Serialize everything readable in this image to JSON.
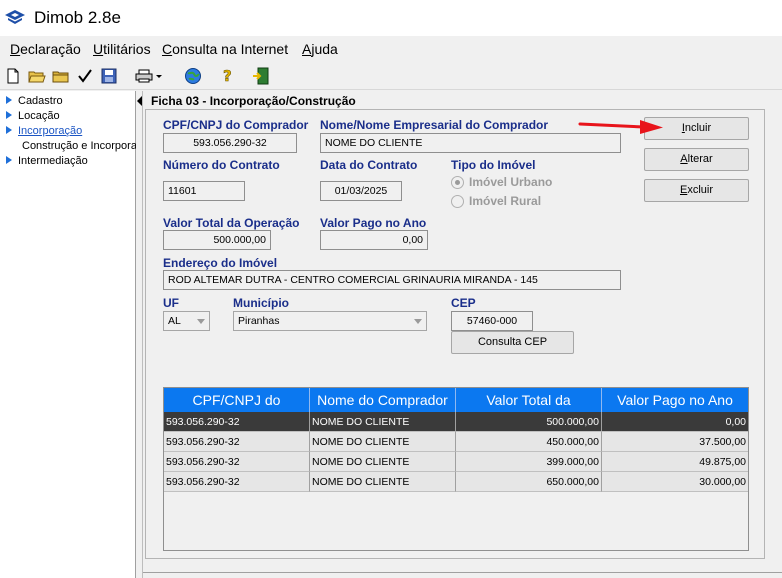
{
  "app": {
    "title": "Dimob 2.8e"
  },
  "menu": [
    {
      "ul": "D",
      "rest": "eclaração"
    },
    {
      "ul": "U",
      "rest": "tilitários"
    },
    {
      "ul": "C",
      "rest": "onsulta na Internet"
    },
    {
      "ul": "A",
      "rest": "juda"
    }
  ],
  "toolbar": {
    "icons": [
      "new-file-icon",
      "open-folder-icon",
      "folder-icon",
      "check-icon",
      "save-icon",
      "print-icon",
      "globe-icon",
      "help-icon",
      "exit-icon"
    ]
  },
  "sidebar": {
    "items": [
      {
        "label": "Cadastro"
      },
      {
        "label": "Locação"
      },
      {
        "label": "Incorporação"
      },
      {
        "label": "Intermediação"
      }
    ],
    "sub_item": "Construção e Incorporação"
  },
  "form": {
    "section_title": "Ficha 03 - Incorporação/Construção",
    "cpf_label": "CPF/CNPJ do Comprador",
    "cpf_value": "593.056.290-32",
    "nome_label": "Nome/Nome Empresarial do Comprador",
    "nome_value": "NOME DO CLIENTE",
    "contrato_label": "Número do Contrato",
    "contrato_value": "11601",
    "data_label": "Data do Contrato",
    "data_value": "01/03/2025",
    "tipo_label": "Tipo do Imóvel",
    "tipo_urbano": "Imóvel Urbano",
    "tipo_rural": "Imóvel Rural",
    "tipo_selected": "Imóvel Urbano",
    "valor_total_label": "Valor Total da Operação",
    "valor_total_value": "500.000,00",
    "valor_pago_label": "Valor Pago no Ano",
    "valor_pago_value": "0,00",
    "endereco_label": "Endereço do Imóvel",
    "endereco_value": "ROD ALTEMAR DUTRA - CENTRO COMERCIAL GRINAURIA MIRANDA - 145",
    "uf_label": "UF",
    "uf_value": "AL",
    "municipio_label": "Município",
    "municipio_value": "Piranhas",
    "cep_label": "CEP",
    "cep_value": "57460-000"
  },
  "buttons": {
    "incluir": {
      "ul": "I",
      "rest": "ncluir"
    },
    "alterar": {
      "ul": "A",
      "rest": "lterar"
    },
    "excluir": {
      "ul": "E",
      "rest": "xcluir"
    },
    "consulta_cep": "Consulta CEP"
  },
  "table": {
    "columns": [
      "CPF/CNPJ do",
      "Nome do Comprador",
      "Valor Total da",
      "Valor Pago no Ano"
    ],
    "rows": [
      {
        "cpf": "593.056.290-32",
        "nome": "NOME DO CLIENTE",
        "total": "500.000,00",
        "pago": "0,00"
      },
      {
        "cpf": "593.056.290-32",
        "nome": "NOME DO CLIENTE",
        "total": "450.000,00",
        "pago": "37.500,00"
      },
      {
        "cpf": "593.056.290-32",
        "nome": "NOME DO CLIENTE",
        "total": "399.000,00",
        "pago": "49.875,00"
      },
      {
        "cpf": "593.056.290-32",
        "nome": "NOME DO CLIENTE",
        "total": "650.000,00",
        "pago": "30.000,00"
      }
    ],
    "selected_row": 0
  },
  "colors": {
    "label_blue": "#1a2e8a",
    "header_blue": "#0b78f0",
    "annotation_red": "#e8141b"
  }
}
